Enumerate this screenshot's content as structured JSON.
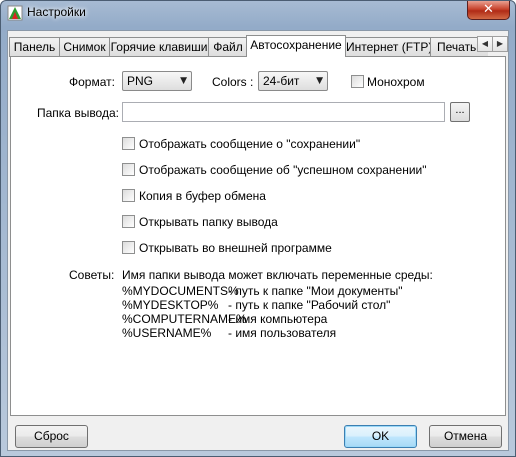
{
  "window": {
    "title": "Настройки",
    "close_glyph": "✕"
  },
  "tabs": [
    {
      "label": "Панель",
      "active": false
    },
    {
      "label": "Снимок",
      "active": false
    },
    {
      "label": "Горячие клавиши",
      "active": false
    },
    {
      "label": "Файл",
      "active": false
    },
    {
      "label": "Автосохранение",
      "active": true
    },
    {
      "label": "Интернет (FTP)",
      "active": false
    },
    {
      "label": "Печать",
      "active": false
    }
  ],
  "tab_scroll": {
    "left": "◀",
    "right": "▶"
  },
  "format": {
    "label": "Формат:",
    "value": "PNG"
  },
  "colors": {
    "label": "Colors :",
    "value": "24-бит"
  },
  "monochrome": {
    "label": "Монохром",
    "checked": false
  },
  "output_folder": {
    "label": "Папка вывода:",
    "value": "",
    "browse_label": "..."
  },
  "options": [
    {
      "label": "Отображать сообщение о \"сохранении\"",
      "checked": false
    },
    {
      "label": "Отображать сообщение об \"успешном сохранении\"",
      "checked": false
    },
    {
      "label": "Копия в буфер обмена",
      "checked": false
    },
    {
      "label": "Открывать папку вывода",
      "checked": false
    },
    {
      "label": "Открывать во внешней программе",
      "checked": false
    }
  ],
  "hints": {
    "label": "Советы:",
    "intro": "Имя папки вывода может включать переменные среды:",
    "vars": [
      {
        "name": "%MYDOCUMENTS%",
        "desc": "- путь к папке \"Мои документы\""
      },
      {
        "name": "%MYDESKTOP%",
        "desc": "- путь к папке \"Рабочий стол\""
      },
      {
        "name": "%COMPUTERNAME%",
        "desc": "- имя компьютера"
      },
      {
        "name": "%USERNAME%",
        "desc": "- имя пользователя"
      }
    ]
  },
  "buttons": {
    "reset": "Сброс",
    "ok": "OK",
    "cancel": "Отмена"
  },
  "colors_theme": {
    "accent": "#3c7fb1",
    "close": "#c8432d"
  }
}
